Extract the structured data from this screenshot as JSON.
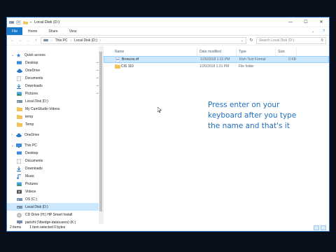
{
  "window": {
    "title": "Local Disk (D:)",
    "controls": [
      "—",
      "☐",
      "✕"
    ]
  },
  "ribbon": {
    "file_tab": "File",
    "tabs": [
      "Home",
      "Share",
      "View"
    ],
    "expand": "⌄",
    "help": "?"
  },
  "address": {
    "path": [
      "This PC",
      "Local Disk (D:)"
    ],
    "search_placeholder": "Search Local Disk (D:)"
  },
  "nav_pane": {
    "items": [
      {
        "label": "Quick access",
        "level": "top",
        "icon": "star-icon",
        "arrow": "⌄"
      },
      {
        "label": "Desktop",
        "level": "child",
        "icon": "desktop-icon",
        "pinned": true
      },
      {
        "label": "OneDrive",
        "level": "child",
        "icon": "cloud-icon",
        "pinned": true
      },
      {
        "label": "Documents",
        "level": "child",
        "icon": "documents-icon",
        "pinned": true
      },
      {
        "label": "Downloads",
        "level": "child",
        "icon": "downloads-icon",
        "pinned": true
      },
      {
        "label": "Pictures",
        "level": "child",
        "icon": "pictures-icon",
        "pinned": true
      },
      {
        "label": "Local Disk (D:)",
        "level": "child",
        "icon": "drive-icon",
        "pinned": false
      },
      {
        "label": "My CamStudio Videos",
        "level": "child",
        "icon": "folder-icon",
        "pinned": false
      },
      {
        "label": "temp",
        "level": "child",
        "icon": "folder-icon",
        "pinned": false
      },
      {
        "label": "Temp",
        "level": "child",
        "icon": "folder-icon",
        "pinned": false
      },
      {
        "label": "OneDrive",
        "level": "top",
        "icon": "cloud-icon",
        "arrow": "›"
      },
      {
        "label": "This PC",
        "level": "top",
        "icon": "computer-icon",
        "arrow": "⌄"
      },
      {
        "label": "Desktop",
        "level": "child",
        "icon": "desktop-icon"
      },
      {
        "label": "Documents",
        "level": "child",
        "icon": "documents-icon"
      },
      {
        "label": "Downloads",
        "level": "child",
        "icon": "downloads-icon"
      },
      {
        "label": "Music",
        "level": "child",
        "icon": "music-icon"
      },
      {
        "label": "Pictures",
        "level": "child",
        "icon": "pictures-icon"
      },
      {
        "label": "Videos",
        "level": "child",
        "icon": "videos-icon"
      },
      {
        "label": "OS (C:)",
        "level": "child",
        "icon": "drive-icon"
      },
      {
        "label": "Local Disk (D:)",
        "level": "child",
        "icon": "drive-icon",
        "selected": true
      },
      {
        "label": "CD Drive (H:) HP Smart Install",
        "level": "child",
        "icon": "cd-icon"
      },
      {
        "label": "parisht (\\\\tbedge-data\\users) (K:)",
        "level": "child",
        "icon": "network-drive-icon"
      }
    ]
  },
  "columns": [
    "Name",
    "Date modified",
    "Type",
    "Size"
  ],
  "files": [
    {
      "name": "Broncos.rtf",
      "date": "1/26/2018 1:32 PM",
      "type": "Rich Text Format",
      "size": "0 KB",
      "icon": "rtf-file-icon",
      "selected": true
    },
    {
      "name": "CIS 110",
      "date": "1/26/2018 1:31 PM",
      "type": "File folder",
      "size": "",
      "icon": "folder-icon",
      "selected": false
    }
  ],
  "caption": {
    "lines": [
      "Press enter on your",
      "keyboard after you type",
      "the name and that's it"
    ]
  },
  "status": {
    "item_count": "2 items",
    "selection": "1 item selected  0 bytes"
  },
  "colors": {
    "accent": "#1979ca",
    "caption": "#1f6fc0",
    "selection": "#cce8ff",
    "folder": "#f2c35a"
  }
}
